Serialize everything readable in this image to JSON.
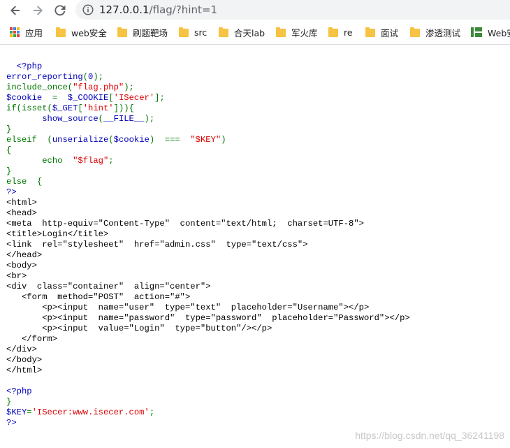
{
  "browser": {
    "url_host": "127.0.0.1",
    "url_path": "/flag/?hint=1",
    "nav": {
      "back_icon": "back-arrow-icon",
      "forward_icon": "forward-arrow-icon",
      "reload_icon": "reload-icon"
    }
  },
  "bookmarks": [
    {
      "label": "应用",
      "icon": "apps-grid-icon"
    },
    {
      "label": "web安全",
      "icon": "folder-icon"
    },
    {
      "label": "刷题靶场",
      "icon": "folder-icon"
    },
    {
      "label": "src",
      "icon": "folder-icon"
    },
    {
      "label": "合天lab",
      "icon": "folder-icon"
    },
    {
      "label": "军火库",
      "icon": "folder-icon"
    },
    {
      "label": "re",
      "icon": "folder-icon"
    },
    {
      "label": "面试",
      "icon": "folder-icon"
    },
    {
      "label": "渗透测试",
      "icon": "folder-icon"
    },
    {
      "label": "Web安",
      "icon": "web-favicon-icon"
    }
  ],
  "colors": {
    "keyword": "#007700",
    "default": "#0000bb",
    "string": "#dd0000",
    "html": "#000000"
  },
  "code_lines": [
    [
      {
        "t": "  <?php",
        "c": "d"
      }
    ],
    [
      {
        "t": "error_reporting",
        "c": "d"
      },
      {
        "t": "(",
        "c": "k"
      },
      {
        "t": "0",
        "c": "d"
      },
      {
        "t": ");",
        "c": "k"
      }
    ],
    [
      {
        "t": "include_once",
        "c": "k"
      },
      {
        "t": "(",
        "c": "k"
      },
      {
        "t": "\"flag.php\"",
        "c": "s"
      },
      {
        "t": ");",
        "c": "k"
      }
    ],
    [
      {
        "t": "$cookie ",
        "c": "d"
      },
      {
        "t": " = ",
        "c": "k"
      },
      {
        "t": " $_COOKIE",
        "c": "d"
      },
      {
        "t": "[",
        "c": "k"
      },
      {
        "t": "'ISecer'",
        "c": "s"
      },
      {
        "t": "];",
        "c": "k"
      }
    ],
    [
      {
        "t": "if(isset(",
        "c": "k"
      },
      {
        "t": "$_GET",
        "c": "d"
      },
      {
        "t": "[",
        "c": "k"
      },
      {
        "t": "'hint'",
        "c": "s"
      },
      {
        "t": "])){",
        "c": "k"
      }
    ],
    [
      {
        "t": "       show_source",
        "c": "d"
      },
      {
        "t": "(",
        "c": "k"
      },
      {
        "t": "__FILE__",
        "c": "d"
      },
      {
        "t": ");",
        "c": "k"
      }
    ],
    [
      {
        "t": "}",
        "c": "k"
      }
    ],
    [
      {
        "t": "elseif ",
        "c": "k"
      },
      {
        "t": " (",
        "c": "k"
      },
      {
        "t": "unserialize",
        "c": "d"
      },
      {
        "t": "(",
        "c": "k"
      },
      {
        "t": "$cookie",
        "c": "d"
      },
      {
        "t": ") ",
        "c": "k"
      },
      {
        "t": " === ",
        "c": "k"
      },
      {
        "t": " \"$KEY\"",
        "c": "s"
      },
      {
        "t": ")",
        "c": "k"
      }
    ],
    [
      {
        "t": "{",
        "c": "k"
      }
    ],
    [
      {
        "t": "       echo ",
        "c": "k"
      },
      {
        "t": " \"$flag\"",
        "c": "s"
      },
      {
        "t": ";",
        "c": "k"
      }
    ],
    [
      {
        "t": "}",
        "c": "k"
      }
    ],
    [
      {
        "t": "else ",
        "c": "k"
      },
      {
        "t": " {",
        "c": "k"
      }
    ],
    [
      {
        "t": "?>",
        "c": "d"
      }
    ],
    [
      {
        "t": "<html>",
        "c": "h"
      }
    ],
    [
      {
        "t": "<head>",
        "c": "h"
      }
    ],
    [
      {
        "t": "<meta  http-equiv=\"Content-Type\"  content=\"text/html;  charset=UTF-8\">",
        "c": "h"
      }
    ],
    [
      {
        "t": "<title>Login</title>",
        "c": "h"
      }
    ],
    [
      {
        "t": "<link  rel=\"stylesheet\"  href=\"admin.css\"  type=\"text/css\">",
        "c": "h"
      }
    ],
    [
      {
        "t": "</head>",
        "c": "h"
      }
    ],
    [
      {
        "t": "<body>",
        "c": "h"
      }
    ],
    [
      {
        "t": "<br>",
        "c": "h"
      }
    ],
    [
      {
        "t": "<div  class=\"container\"  align=\"center\">",
        "c": "h"
      }
    ],
    [
      {
        "t": "   <form  method=\"POST\"  action=\"#\">",
        "c": "h"
      }
    ],
    [
      {
        "t": "       <p><input  name=\"user\"  type=\"text\"  placeholder=\"Username\"></p>",
        "c": "h"
      }
    ],
    [
      {
        "t": "       <p><input  name=\"password\"  type=\"password\"  placeholder=\"Password\"></p>",
        "c": "h"
      }
    ],
    [
      {
        "t": "       <p><input  value=\"Login\"  type=\"button\"/></p>",
        "c": "h"
      }
    ],
    [
      {
        "t": "   </form>",
        "c": "h"
      }
    ],
    [
      {
        "t": "</div>",
        "c": "h"
      }
    ],
    [
      {
        "t": "</body>",
        "c": "h"
      }
    ],
    [
      {
        "t": "</html>",
        "c": "h"
      }
    ],
    [
      {
        "t": "",
        "c": "h"
      }
    ],
    [
      {
        "t": "<?php",
        "c": "d"
      }
    ],
    [
      {
        "t": "}",
        "c": "k"
      }
    ],
    [
      {
        "t": "$KEY",
        "c": "d"
      },
      {
        "t": "=",
        "c": "k"
      },
      {
        "t": "'ISecer:www.isecer.com'",
        "c": "s"
      },
      {
        "t": ";",
        "c": "k"
      }
    ],
    [
      {
        "t": "?>",
        "c": "d"
      }
    ]
  ],
  "watermark": "https://blog.csdn.net/qq_36241198"
}
